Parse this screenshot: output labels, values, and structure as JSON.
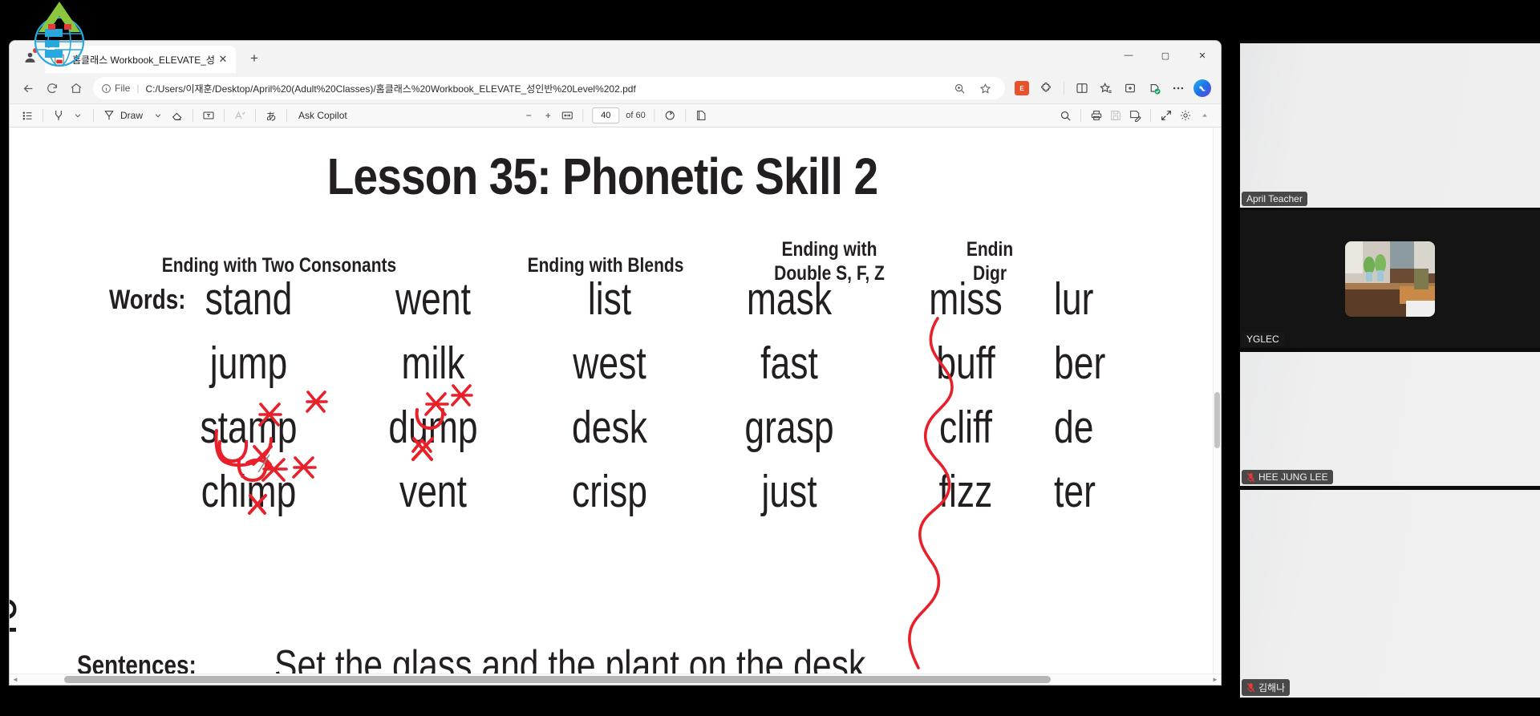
{
  "browser": {
    "tab": {
      "title": "홈클래스 Workbook_ELEVATE_성",
      "favicon_label": "PDF",
      "close_label": "✕",
      "newtab_label": "+"
    },
    "window_controls": {
      "minimize": "—",
      "maximize": "▢",
      "close": "✕"
    },
    "nav": {
      "back": "←",
      "forward": "→",
      "refresh": "⟳",
      "home": "⌂",
      "file_label": "File",
      "separator": "|",
      "url": "C:/Users/이재훈/Desktop/April%20(Adult%20Classes)/홈클래스%20Workbook_ELEVATE_성인반%20Level%202.pdf",
      "zoom_icon": "zoom-icon",
      "favorite_icon": "star-icon",
      "extension_label": "E",
      "icons": [
        "split-screen-icon",
        "favorites-icon",
        "collections-icon",
        "browser-essentials-icon",
        "more-options-icon",
        "copilot-icon"
      ]
    }
  },
  "pdf_toolbar": {
    "left": [
      {
        "name": "table-of-contents",
        "glyph": "☰"
      },
      {
        "name": "highlighter",
        "glyph": "highlighter"
      },
      {
        "name": "highlighter-dropdown",
        "glyph": "⌄"
      },
      {
        "name": "draw",
        "glyph": "pen",
        "label": "Draw"
      },
      {
        "name": "draw-dropdown",
        "glyph": "⌄"
      },
      {
        "name": "erase",
        "glyph": "eraser"
      },
      {
        "name": "add-text",
        "glyph": "T"
      },
      {
        "name": "read-aloud",
        "glyph": "A"
      },
      {
        "name": "translate",
        "glyph": "あ"
      },
      {
        "name": "ask-copilot",
        "label": "Ask Copilot"
      }
    ],
    "center": {
      "zoom_out": "−",
      "zoom_in": "+",
      "fit_page": "fit-to-width-icon",
      "current_page": "40",
      "total_pages": "of 60",
      "rotate": "rotate-icon",
      "page_view": "page-view-icon"
    },
    "right": [
      {
        "name": "search",
        "glyph": "search-icon"
      },
      {
        "name": "print",
        "glyph": "print-icon"
      },
      {
        "name": "save",
        "glyph": "save-icon",
        "disabled": true
      },
      {
        "name": "save-as",
        "glyph": "save-as-icon"
      },
      {
        "name": "fit-screen",
        "glyph": "expand-icon"
      },
      {
        "name": "settings",
        "glyph": "gear-icon"
      },
      {
        "name": "collapse",
        "glyph": "▲"
      }
    ]
  },
  "document": {
    "title": "Lesson 35: Phonetic Skill 2",
    "page_number": "40",
    "row_labels": {
      "words": "Words:",
      "sentences": "Sentences:"
    },
    "column_headers": [
      "Ending with Two Consonants",
      "Ending with Blends",
      "Ending with\nDouble S, F, Z",
      "Endin\nDigr"
    ],
    "columns": [
      {
        "words": [
          "stand",
          "jump",
          "stamp",
          "chimp"
        ]
      },
      {
        "words": [
          "went",
          "milk",
          "dump",
          "vent"
        ]
      },
      {
        "words": [
          "list",
          "west",
          "desk",
          "crisp"
        ]
      },
      {
        "words": [
          "mask",
          "fast",
          "grasp",
          "just"
        ]
      },
      {
        "words": [
          "miss",
          "buff",
          "cliff",
          "fizz"
        ]
      },
      {
        "words": [
          "lur",
          "ber",
          "de",
          "ter"
        ]
      }
    ],
    "sentence": "Set the glass and the plant on the desk.",
    "annotation_color": "#e8202a"
  },
  "participants": [
    {
      "name": "April Teacher",
      "muted": false,
      "speaking": true,
      "has_thumb": false
    },
    {
      "name": "YGLEC",
      "muted": false,
      "speaking": false,
      "has_thumb": true
    },
    {
      "name": "HEE JUNG LEE",
      "muted": true,
      "speaking": false,
      "has_thumb": false
    },
    {
      "name": "김해나",
      "muted": true,
      "speaking": false,
      "has_thumb": false
    }
  ],
  "colors": {
    "speaking_border": "#36d77c",
    "mute_red": "#e03a3a",
    "accent_blue": "#1a73e8",
    "annotation_red": "#e8202a",
    "panel_bg": "#0b0b0b"
  }
}
